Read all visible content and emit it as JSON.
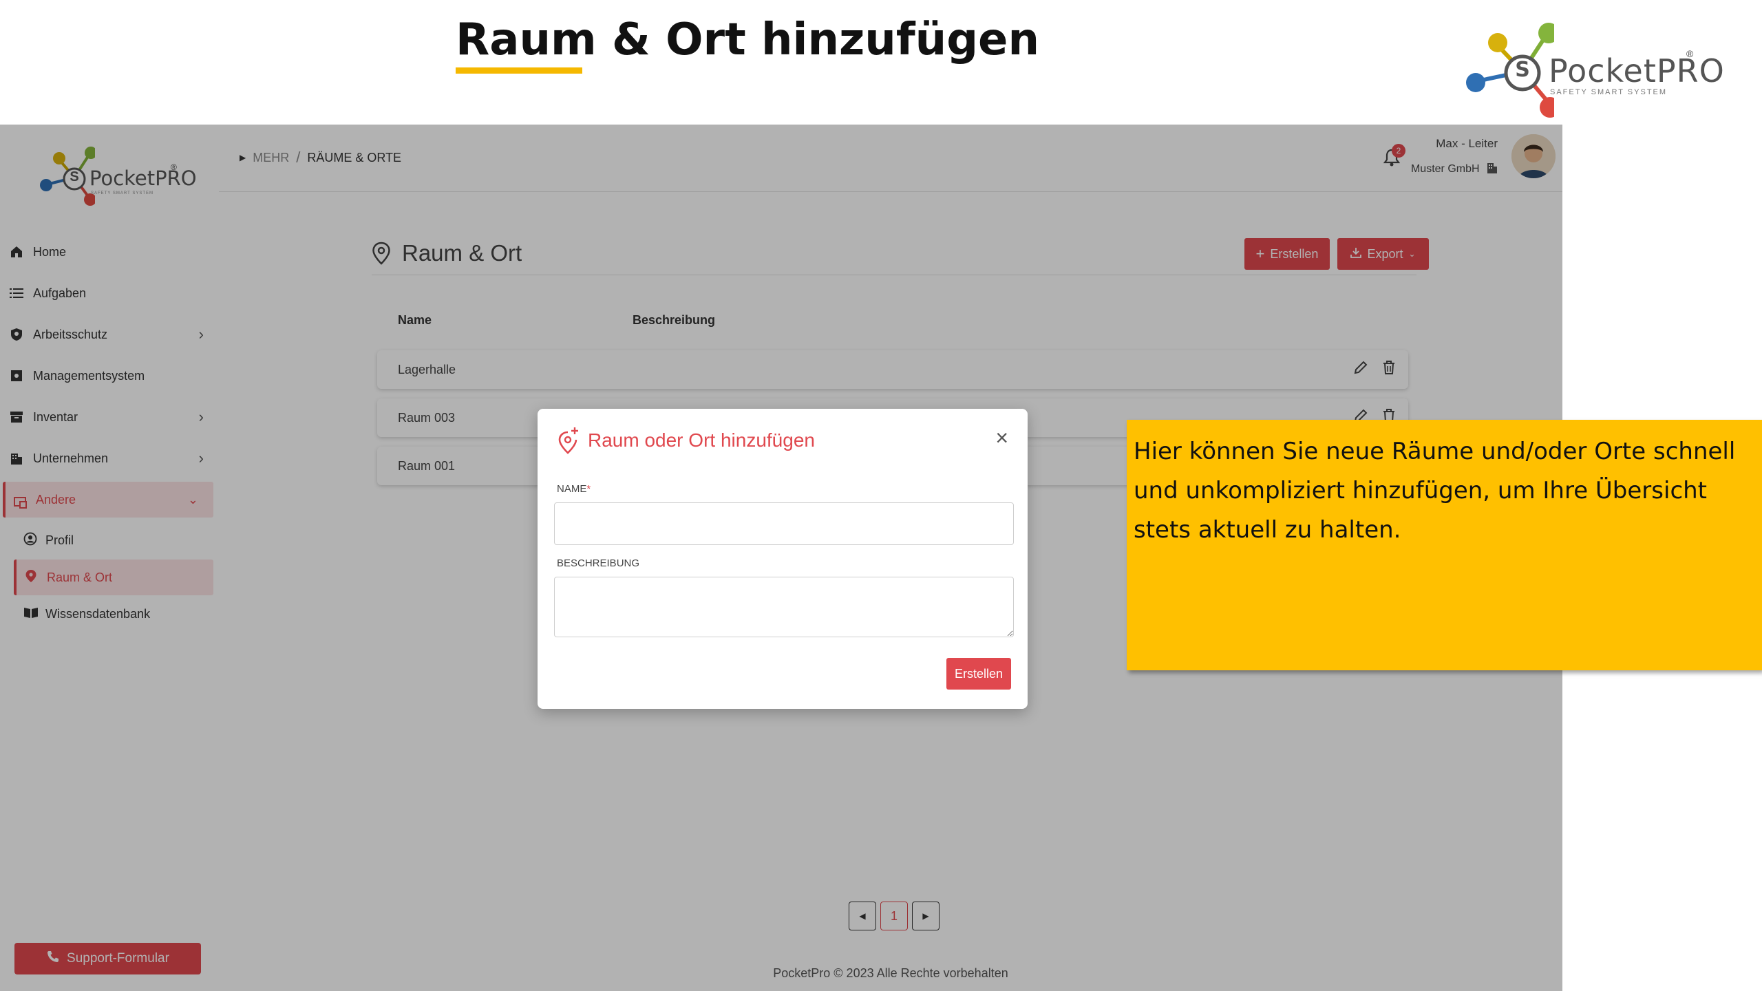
{
  "slide": {
    "title": "Raum & Ort hinzufügen",
    "brand": {
      "name": "PocketPRO",
      "tagline": "SAFETY  SMART  SYSTEM",
      "reg": "®",
      "letter": "S"
    }
  },
  "sidebar": {
    "logo": {
      "name": "PocketPRO",
      "tagline": "SAFETY SMART SYSTEM",
      "reg": "®",
      "letter": "S"
    },
    "items": [
      {
        "label": "Home",
        "icon": "home-icon"
      },
      {
        "label": "Aufgaben",
        "icon": "list-icon"
      },
      {
        "label": "Arbeitsschutz",
        "icon": "shield-icon",
        "chevron": "›"
      },
      {
        "label": "Managementsystem",
        "icon": "management-icon"
      },
      {
        "label": "Inventar",
        "icon": "archive-icon",
        "chevron": "›"
      },
      {
        "label": "Unternehmen",
        "icon": "building-icon",
        "chevron": "›"
      },
      {
        "label": "Andere",
        "icon": "others-icon",
        "chevron": "⌄",
        "active": true
      }
    ],
    "sub_items": [
      {
        "label": "Profil",
        "icon": "user-circle-icon"
      },
      {
        "label": "Raum & Ort",
        "icon": "location-pin-icon",
        "active": true
      },
      {
        "label": "Wissensdatenbank",
        "icon": "book-icon"
      }
    ],
    "support_label": "Support-Formular"
  },
  "topbar": {
    "breadcrumb": [
      "MEHR",
      "RÄUME & ORTE"
    ],
    "separator": "/",
    "notifications": "2",
    "user_name": "Max - Leiter",
    "company": "Muster GmbH"
  },
  "main": {
    "title": "Raum & Ort",
    "create_label": "Erstellen",
    "export_label": "Export",
    "columns": [
      "Name",
      "Beschreibung"
    ],
    "rows": [
      {
        "name": "Lagerhalle"
      },
      {
        "name": "Raum 003"
      },
      {
        "name": "Raum 001"
      }
    ],
    "pagination": {
      "current": "1"
    },
    "footer": "PocketPro © 2023 Alle Rechte vorbehalten"
  },
  "modal": {
    "title": "Raum oder Ort hinzufügen",
    "name_label": "NAME",
    "required_mark": "*",
    "description_label": "BESCHREIBUNG",
    "name_value": "",
    "description_value": "",
    "submit_label": "Erstellen",
    "close": "×"
  },
  "callout": {
    "text": "Hier können Sie neue Räume und/oder Orte schnell und unkompliziert hinzufügen, um Ihre Übersicht stets aktuell zu halten."
  },
  "colors": {
    "accent": "#e0484e",
    "callout": "#ffc000",
    "underline": "#f5b800"
  }
}
